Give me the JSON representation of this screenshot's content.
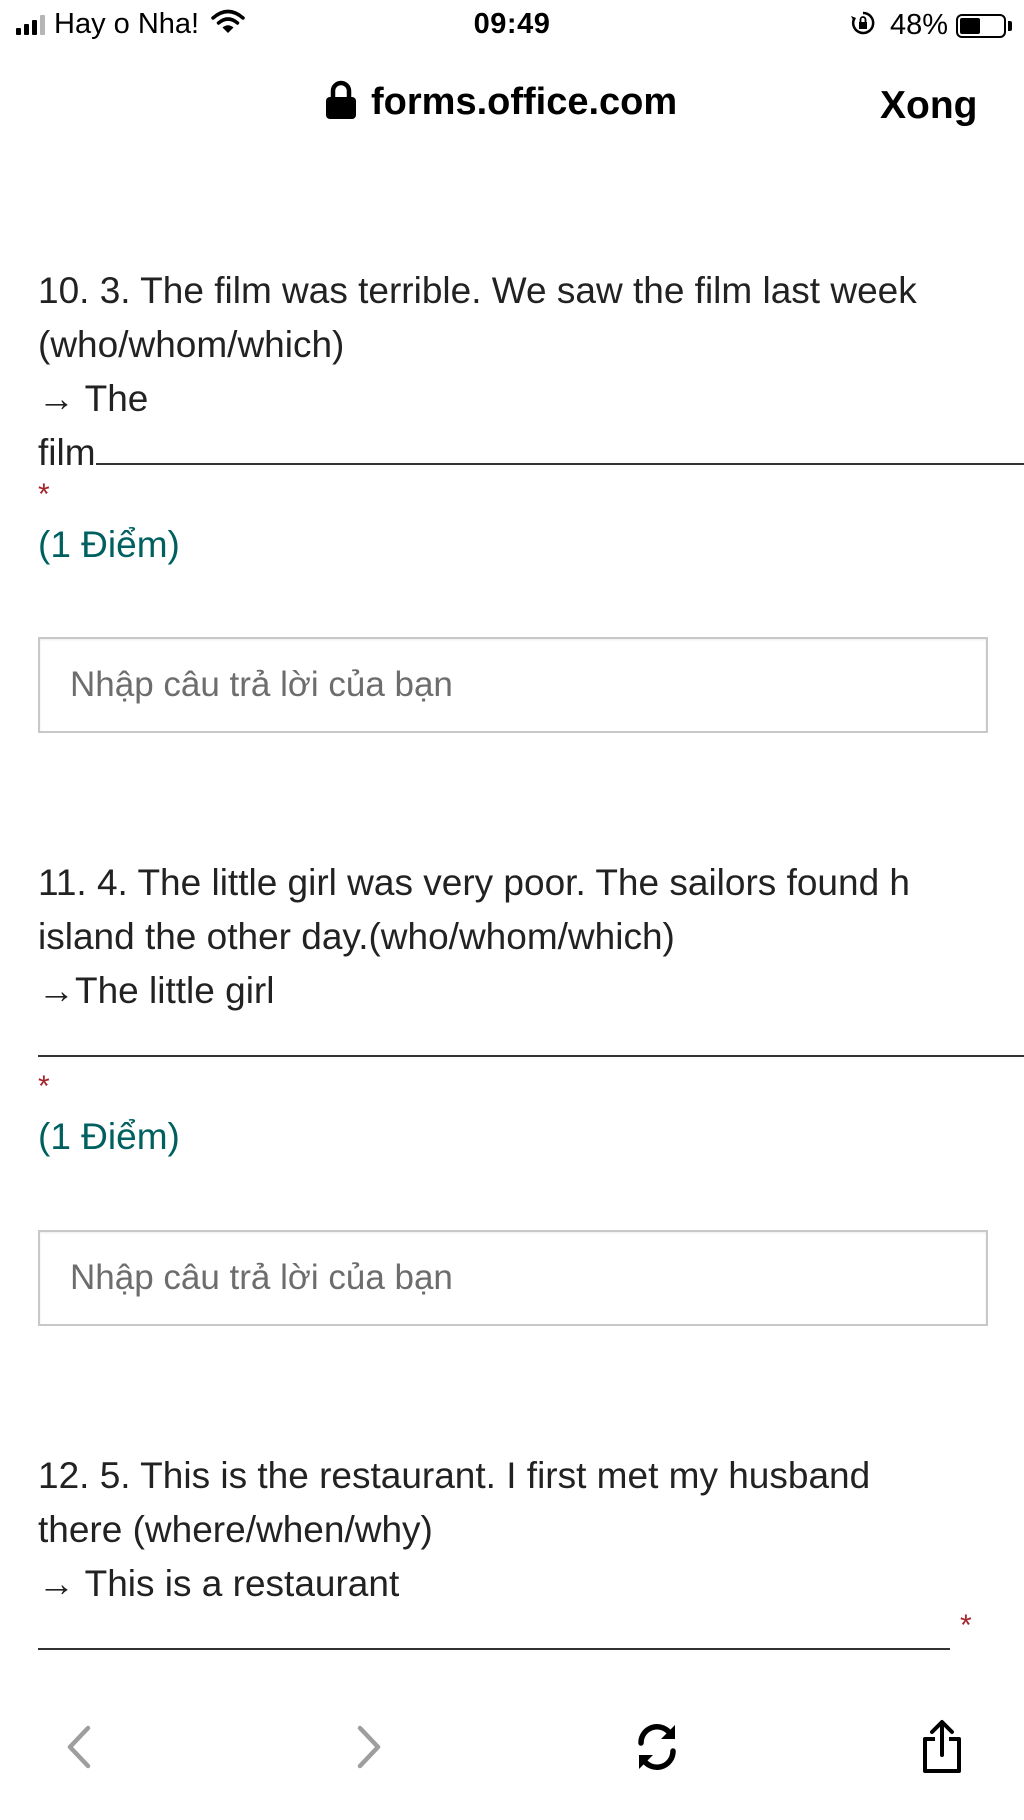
{
  "status_bar": {
    "carrier": "Hay o Nha!",
    "time": "09:49",
    "battery_percent": "48%",
    "battery_level": 0.48,
    "icons": [
      "signal-icon",
      "wifi-icon",
      "orientation-lock-icon",
      "battery-icon"
    ]
  },
  "browser": {
    "url": "forms.office.com",
    "done_label": "Xong",
    "lock_icon": "lock-icon"
  },
  "questions": [
    {
      "lines": [
        "10. 3. The film was terrible. We saw the film last week",
        "(who/whom/which)",
        "→ The",
        "film"
      ],
      "required_marker": "*",
      "points": "(1 Điểm)",
      "placeholder": "Nhập câu trả lời của bạn"
    },
    {
      "lines": [
        "11. 4. The little girl was very poor. The sailors found h",
        "island the other day.(who/whom/which)",
        "→The little girl"
      ],
      "required_marker": "*",
      "points": "(1 Điểm)",
      "placeholder": "Nhập câu trả lời của bạn"
    },
    {
      "lines": [
        "12. 5. This is the restaurant. I first met my husband",
        "there (where/when/why)",
        "→ This is a restaurant"
      ],
      "required_marker": "*"
    }
  ],
  "toolbar": {
    "icons": [
      "back-icon",
      "forward-icon",
      "reload-icon",
      "share-icon"
    ]
  },
  "colors": {
    "points_text": "#006060",
    "required_marker": "#a4262c",
    "disabled_arrow": "#9e9e9e"
  }
}
